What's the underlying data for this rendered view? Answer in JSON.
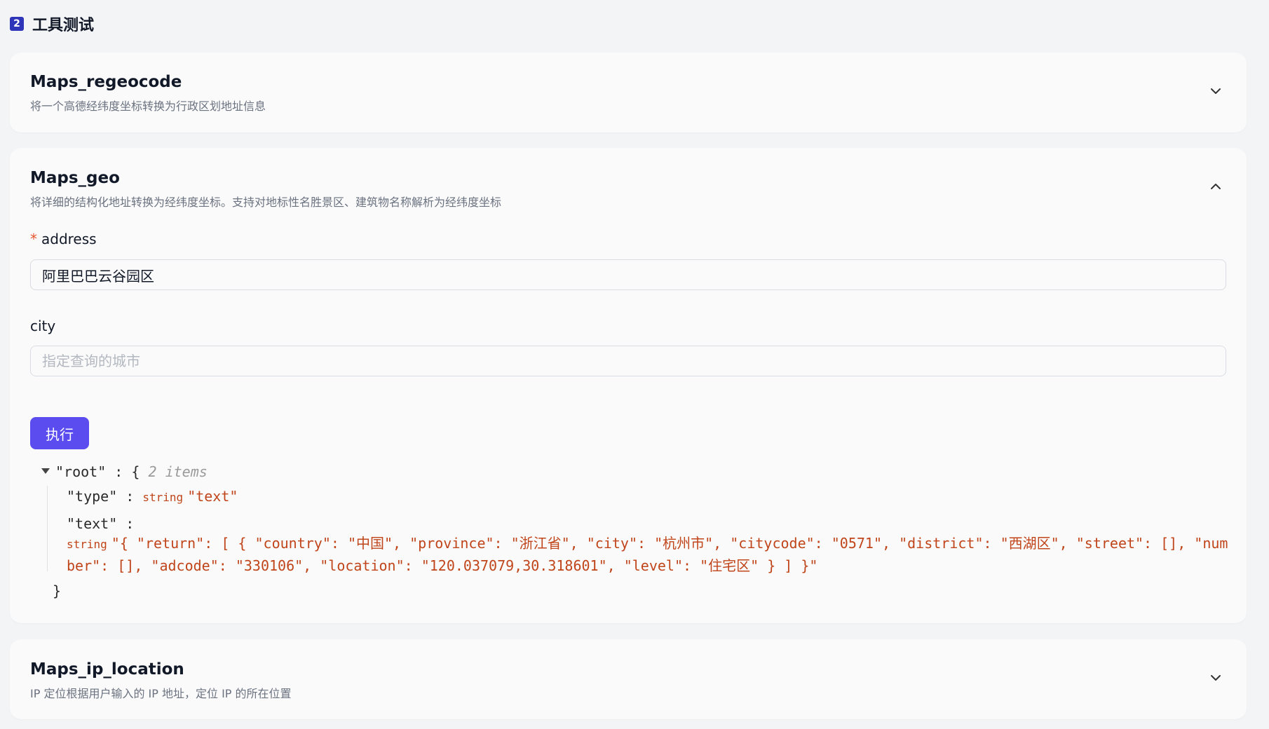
{
  "section": {
    "step": "2",
    "title": "工具测试"
  },
  "tools": [
    {
      "name": "Maps_regeocode",
      "description": "将一个高德经纬度坐标转换为行政区划地址信息",
      "expanded": false
    },
    {
      "name": "Maps_geo",
      "description": "将详细的结构化地址转换为经纬度坐标。支持对地标性名胜景区、建筑物名称解析为经纬度坐标",
      "expanded": true,
      "fields": [
        {
          "label": "address",
          "required": true,
          "value": "阿里巴巴云谷园区",
          "placeholder": ""
        },
        {
          "label": "city",
          "required": false,
          "value": "",
          "placeholder": "指定查询的城市"
        }
      ],
      "execute_label": "执行",
      "result": {
        "root_key": "\"root\"",
        "colon": ":",
        "open_brace": "{",
        "close_brace": "}",
        "items_meta": "2 items",
        "entries": [
          {
            "key": "\"type\"",
            "type": "string",
            "value": "\"text\""
          },
          {
            "key": "\"text\"",
            "type": "string",
            "value": "\"{ \"return\": [ { \"country\": \"中国\", \"province\": \"浙江省\", \"city\": \"杭州市\", \"citycode\": \"0571\", \"district\": \"西湖区\", \"street\": [], \"number\": [], \"adcode\": \"330106\", \"location\": \"120.037079,30.318601\", \"level\": \"住宅区\" } ] }\""
          }
        ]
      }
    },
    {
      "name": "Maps_ip_location",
      "description": "IP 定位根据用户输入的 IP 地址，定位 IP 的所在位置",
      "expanded": false
    }
  ],
  "colors": {
    "accent": "#5b4cf0",
    "step_badge": "#2f35b8",
    "required": "#e4572e",
    "json_string": "#c0451b"
  }
}
